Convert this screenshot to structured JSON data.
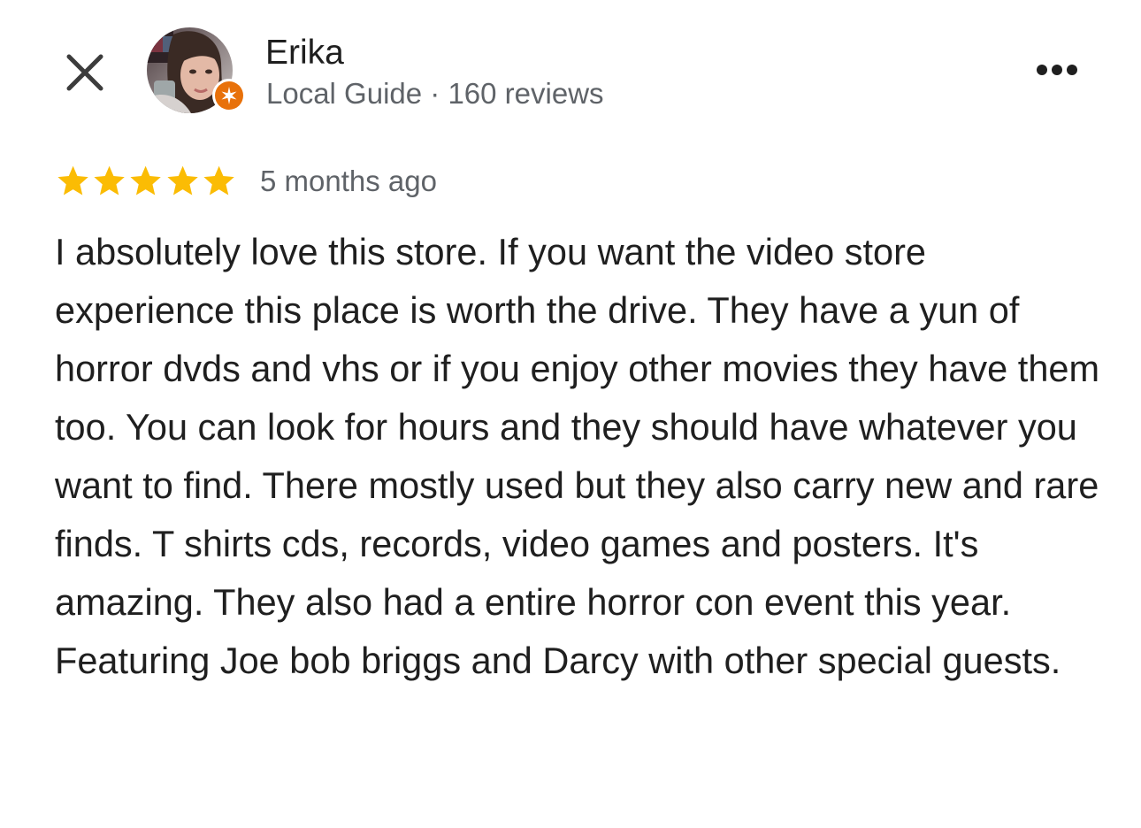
{
  "header": {
    "close_icon": "close-icon",
    "more_icon": "more-horizontal-icon"
  },
  "reviewer": {
    "name": "Erika",
    "meta": "Local Guide · 160 reviews",
    "badge_icon": "local-guide-star-icon",
    "badge_color": "#e8710a"
  },
  "review": {
    "rating": 5,
    "max_rating": 5,
    "star_color": "#fbbc04",
    "time": "5 months ago",
    "text": "I absolutely love this store. If you want the video store experience this place is worth the drive. They have a yun of horror dvds and vhs or if you enjoy other movies they have them too. You can look for hours and they should have whatever you want to find. There mostly used but they also carry new and rare finds. T shirts cds, records, video games and posters. It's amazing. They also had a entire horror con event this year. Featuring Joe bob briggs and Darcy with other special guests."
  }
}
